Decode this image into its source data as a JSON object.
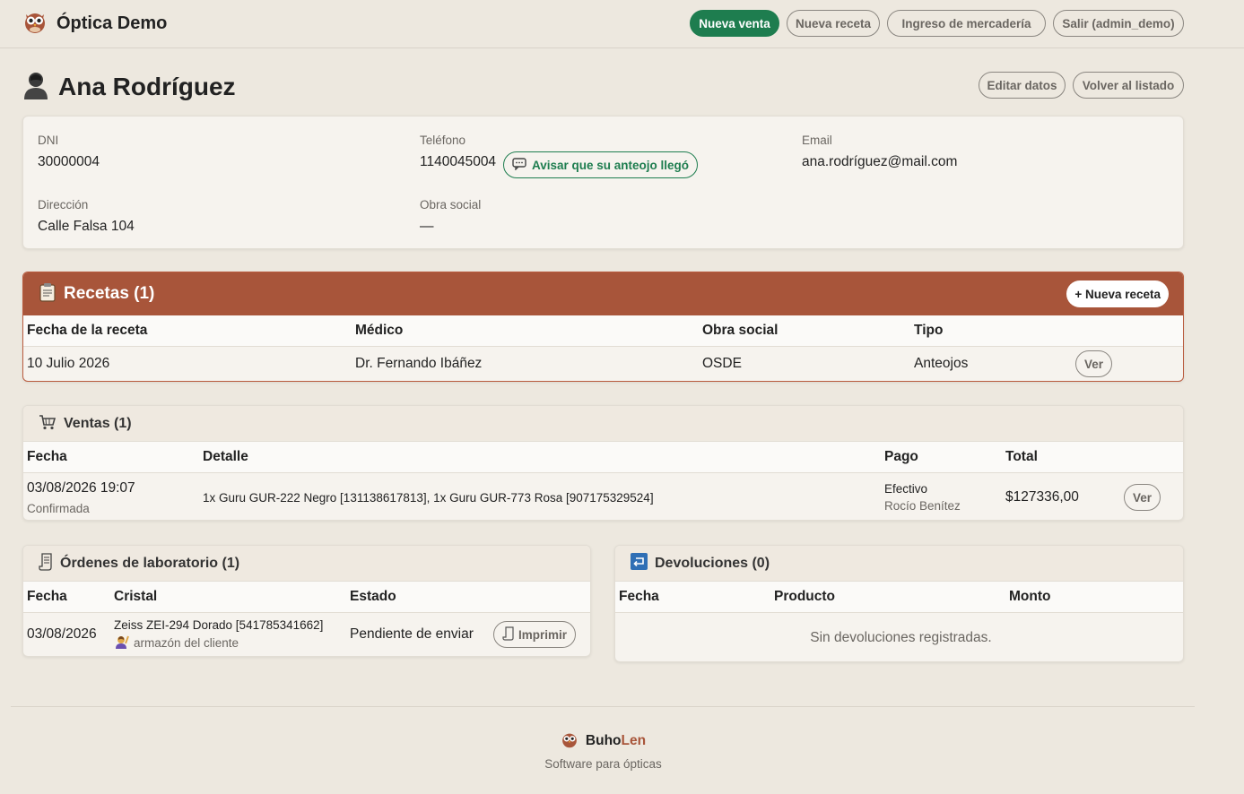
{
  "header": {
    "app_name": "Óptica Demo",
    "nav": {
      "new_sale": "Nueva venta",
      "new_prescription": "Nueva receta",
      "stock_entry": "Ingreso de mercadería",
      "logout": "Salir (admin_demo)"
    }
  },
  "client": {
    "name": "Ana Rodríguez",
    "actions": {
      "edit": "Editar datos",
      "back": "Volver al listado"
    },
    "fields": {
      "dni_label": "DNI",
      "dni": "30000004",
      "phone_label": "Teléfono",
      "phone": "1140045004",
      "notify_button": "Avisar que su anteojo llegó",
      "email_label": "Email",
      "email": "ana.rodríguez@mail.com",
      "address_label": "Dirección",
      "address": "Calle Falsa 104",
      "insurance_label": "Obra social",
      "insurance": "—"
    }
  },
  "prescriptions": {
    "title": "Recetas (1)",
    "new_button": "+ Nueva receta",
    "columns": [
      "Fecha de la receta",
      "Médico",
      "Obra social",
      "Tipo"
    ],
    "rows": [
      {
        "date": "10 Julio 2026",
        "doctor": "Dr. Fernando Ibáñez",
        "insurance": "OSDE",
        "type": "Anteojos",
        "action": "Ver"
      }
    ]
  },
  "sales": {
    "title": "Ventas (1)",
    "columns": [
      "Fecha",
      "Detalle",
      "Pago",
      "Total"
    ],
    "rows": [
      {
        "date": "03/08/2026 19:07",
        "status": "Confirmada",
        "detail": "1x Guru GUR-222 Negro [131138617813], 1x Guru GUR-773 Rosa [907175329524]",
        "payment": "Efectivo",
        "seller": "Rocío Benítez",
        "total": "$127336,00",
        "action": "Ver"
      }
    ]
  },
  "lab_orders": {
    "title": "Órdenes de laboratorio (1)",
    "columns": [
      "Fecha",
      "Cristal",
      "Estado"
    ],
    "rows": [
      {
        "date": "03/08/2026",
        "lens": "Zeiss ZEI-294 Dorado [541785341662]",
        "frame_note": "armazón del cliente",
        "status": "Pendiente de enviar",
        "action": "Imprimir"
      }
    ]
  },
  "returns": {
    "title": "Devoluciones (0)",
    "columns": [
      "Fecha",
      "Producto",
      "Monto"
    ],
    "empty": "Sin devoluciones registradas."
  },
  "footer": {
    "brand_a": "Buho",
    "brand_b": "Len",
    "tagline": "Software para ópticas"
  },
  "colors": {
    "primary_green": "#1e7d4f",
    "brand_rust": "#a8553a",
    "background": "#ede8df"
  },
  "icons": [
    "owl-logo-icon",
    "person-icon",
    "chat-icon",
    "clipboard-icon",
    "cart-icon",
    "scroll-icon",
    "return-icon",
    "raising-hand-icon"
  ]
}
